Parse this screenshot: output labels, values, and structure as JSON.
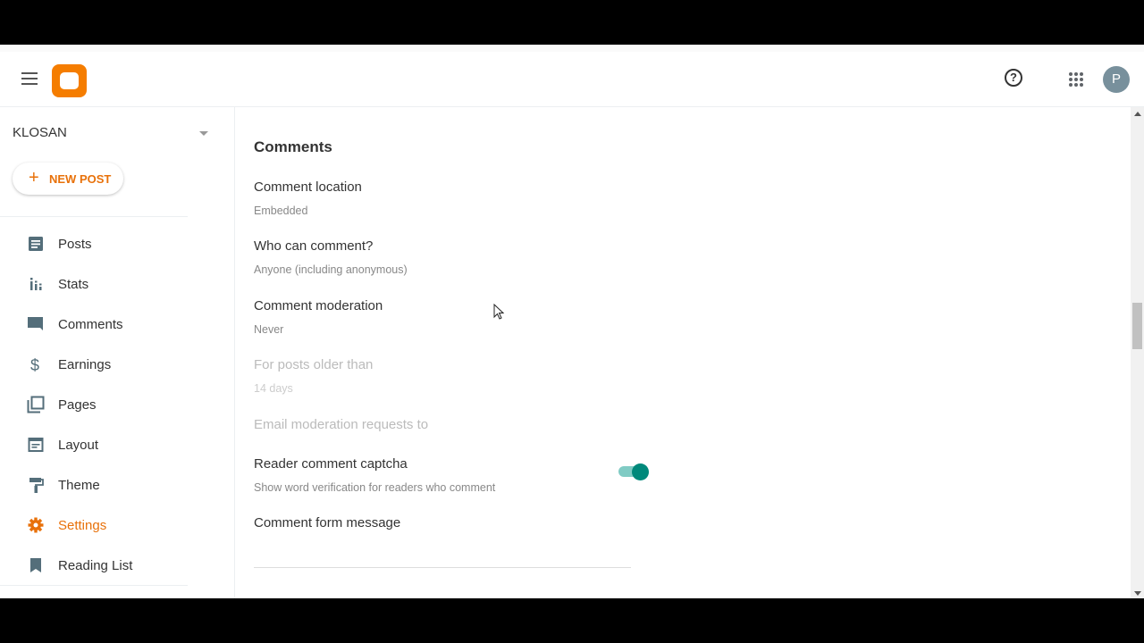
{
  "header": {
    "logo": "blogger-logo",
    "help_icon": "?",
    "avatar_letter": "P"
  },
  "sidebar": {
    "blog_name": "KLOSAN",
    "new_post_plus": "+",
    "new_post_label": "NEW POST",
    "items": [
      {
        "label": "Posts",
        "icon": "posts-icon",
        "active": false
      },
      {
        "label": "Stats",
        "icon": "stats-icon",
        "active": false
      },
      {
        "label": "Comments",
        "icon": "comments-icon",
        "active": false
      },
      {
        "label": "Earnings",
        "icon": "dollar-icon",
        "active": false
      },
      {
        "label": "Pages",
        "icon": "pages-icon",
        "active": false
      },
      {
        "label": "Layout",
        "icon": "layout-icon",
        "active": false
      },
      {
        "label": "Theme",
        "icon": "paint-roller-icon",
        "active": false
      },
      {
        "label": "Settings",
        "icon": "gear-icon",
        "active": true
      },
      {
        "label": "Reading List",
        "icon": "bookmark-icon",
        "active": false
      }
    ]
  },
  "colors": {
    "accent": "#e8710a",
    "brand": "#f57d00",
    "toggle_on": "#00897b",
    "icon_gray": "#546e7a"
  },
  "main": {
    "section_title": "Comments",
    "settings": [
      {
        "label": "Comment location",
        "value": "Embedded",
        "disabled": false
      },
      {
        "label": "Who can comment?",
        "value": "Anyone (including anonymous)",
        "disabled": false
      },
      {
        "label": "Comment moderation",
        "value": "Never",
        "disabled": false
      },
      {
        "label": "For posts older than",
        "value": "14 days",
        "disabled": true
      },
      {
        "label": "Email moderation requests to",
        "value": "",
        "disabled": true
      },
      {
        "label": "Reader comment captcha",
        "value": "Show word verification for readers who comment",
        "disabled": false,
        "toggle_on": true
      },
      {
        "label": "Comment form message",
        "value": "",
        "disabled": false
      }
    ]
  }
}
